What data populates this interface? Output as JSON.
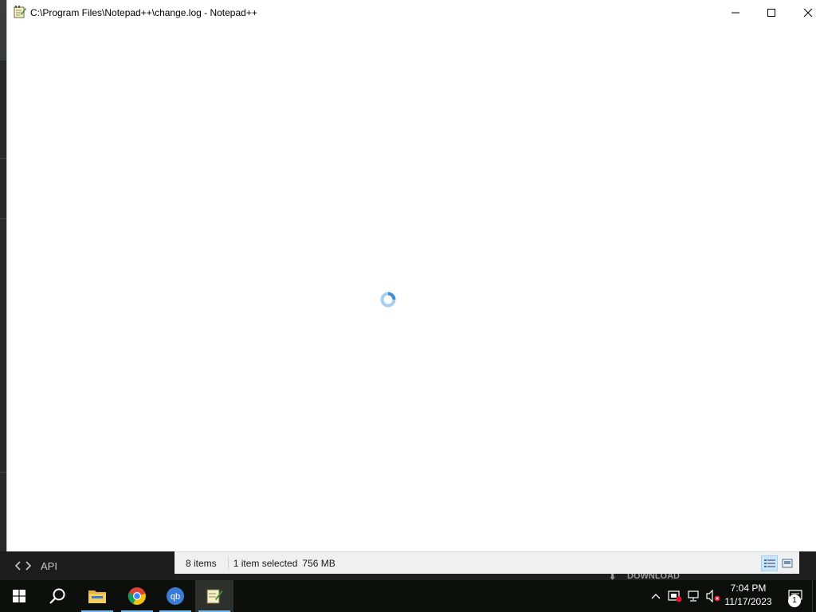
{
  "window": {
    "title": "C:\\Program Files\\Notepad++\\change.log - Notepad++",
    "state": "busy-loading"
  },
  "background_panel": {
    "api_label": "API",
    "download_label": "DOWNLOAD"
  },
  "explorer_status": {
    "item_count": "8 items",
    "selected": "1 item selected",
    "size": "756 MB"
  },
  "taskbar": {
    "apps": [
      "Start",
      "Search",
      "File Explorer",
      "Google Chrome",
      "qBittorrent",
      "Notepad++"
    ],
    "active_app": "Notepad++"
  },
  "tray": {
    "time": "7:04 PM",
    "date": "11/17/2023",
    "notifications": "1"
  },
  "colors": {
    "taskbar_bg": "#0d0f0d",
    "accent": "#76b9ed",
    "spinner": "#3c8fd6"
  }
}
